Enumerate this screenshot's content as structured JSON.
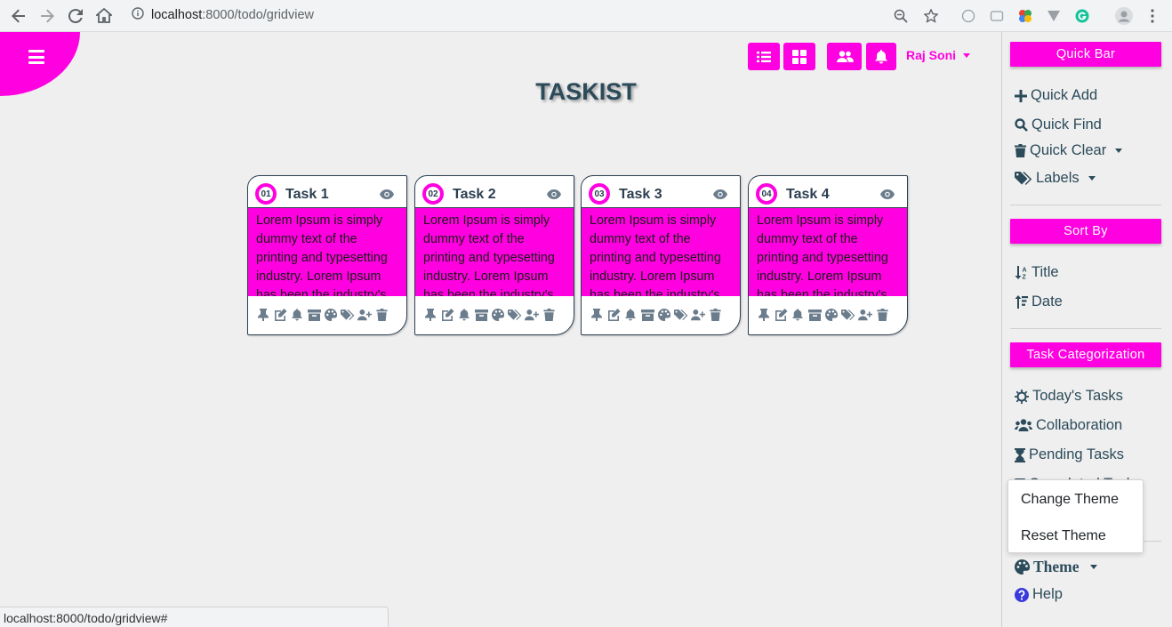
{
  "browser": {
    "url_host": "localhost",
    "url_path": ":8000/todo/gridview",
    "status_url": "localhost:8000/todo/gridview#"
  },
  "header": {
    "title": "TASKIST",
    "user_name": "Raj Soni"
  },
  "tasks": [
    {
      "num": "01",
      "title": "Task 1",
      "body": "Lorem Ipsum is simply dummy text of the printing and typesetting industry. Lorem Ipsum has been the industry's"
    },
    {
      "num": "02",
      "title": "Task 2",
      "body": "Lorem Ipsum is simply dummy text of the printing and typesetting industry. Lorem Ipsum has been the industry's"
    },
    {
      "num": "03",
      "title": "Task 3",
      "body": "Lorem Ipsum is simply dummy text of the printing and typesetting industry. Lorem Ipsum has been the industry's"
    },
    {
      "num": "04",
      "title": "Task 4",
      "body": "Lorem Ipsum is simply dummy text of the printing and typesetting industry. Lorem Ipsum has been the industry's"
    }
  ],
  "card_actions": [
    "pin-icon",
    "edit-icon",
    "bell-icon",
    "archive-icon",
    "palette-icon",
    "tags-icon",
    "user-plus-icon",
    "trash-icon"
  ],
  "sidebar": {
    "quick_bar": "Quick Bar",
    "quick_add": "Quick Add",
    "quick_find": "Quick Find",
    "quick_clear": "Quick Clear",
    "labels": "Labels",
    "sort_by": "Sort By",
    "sort_title": "Title",
    "sort_date": "Date",
    "task_categorization": "Task Categorization",
    "todays_tasks": "Today's Tasks",
    "collaboration": "Collaboration",
    "pending_tasks": "Pending Tasks",
    "completed_tasks": "Completed Tasks",
    "theme": "Theme",
    "help": "Help"
  },
  "theme_menu": {
    "change": "Change Theme",
    "reset": "Reset Theme"
  },
  "colors": {
    "accent": "#ff00e0",
    "text": "#2c4b5a"
  }
}
